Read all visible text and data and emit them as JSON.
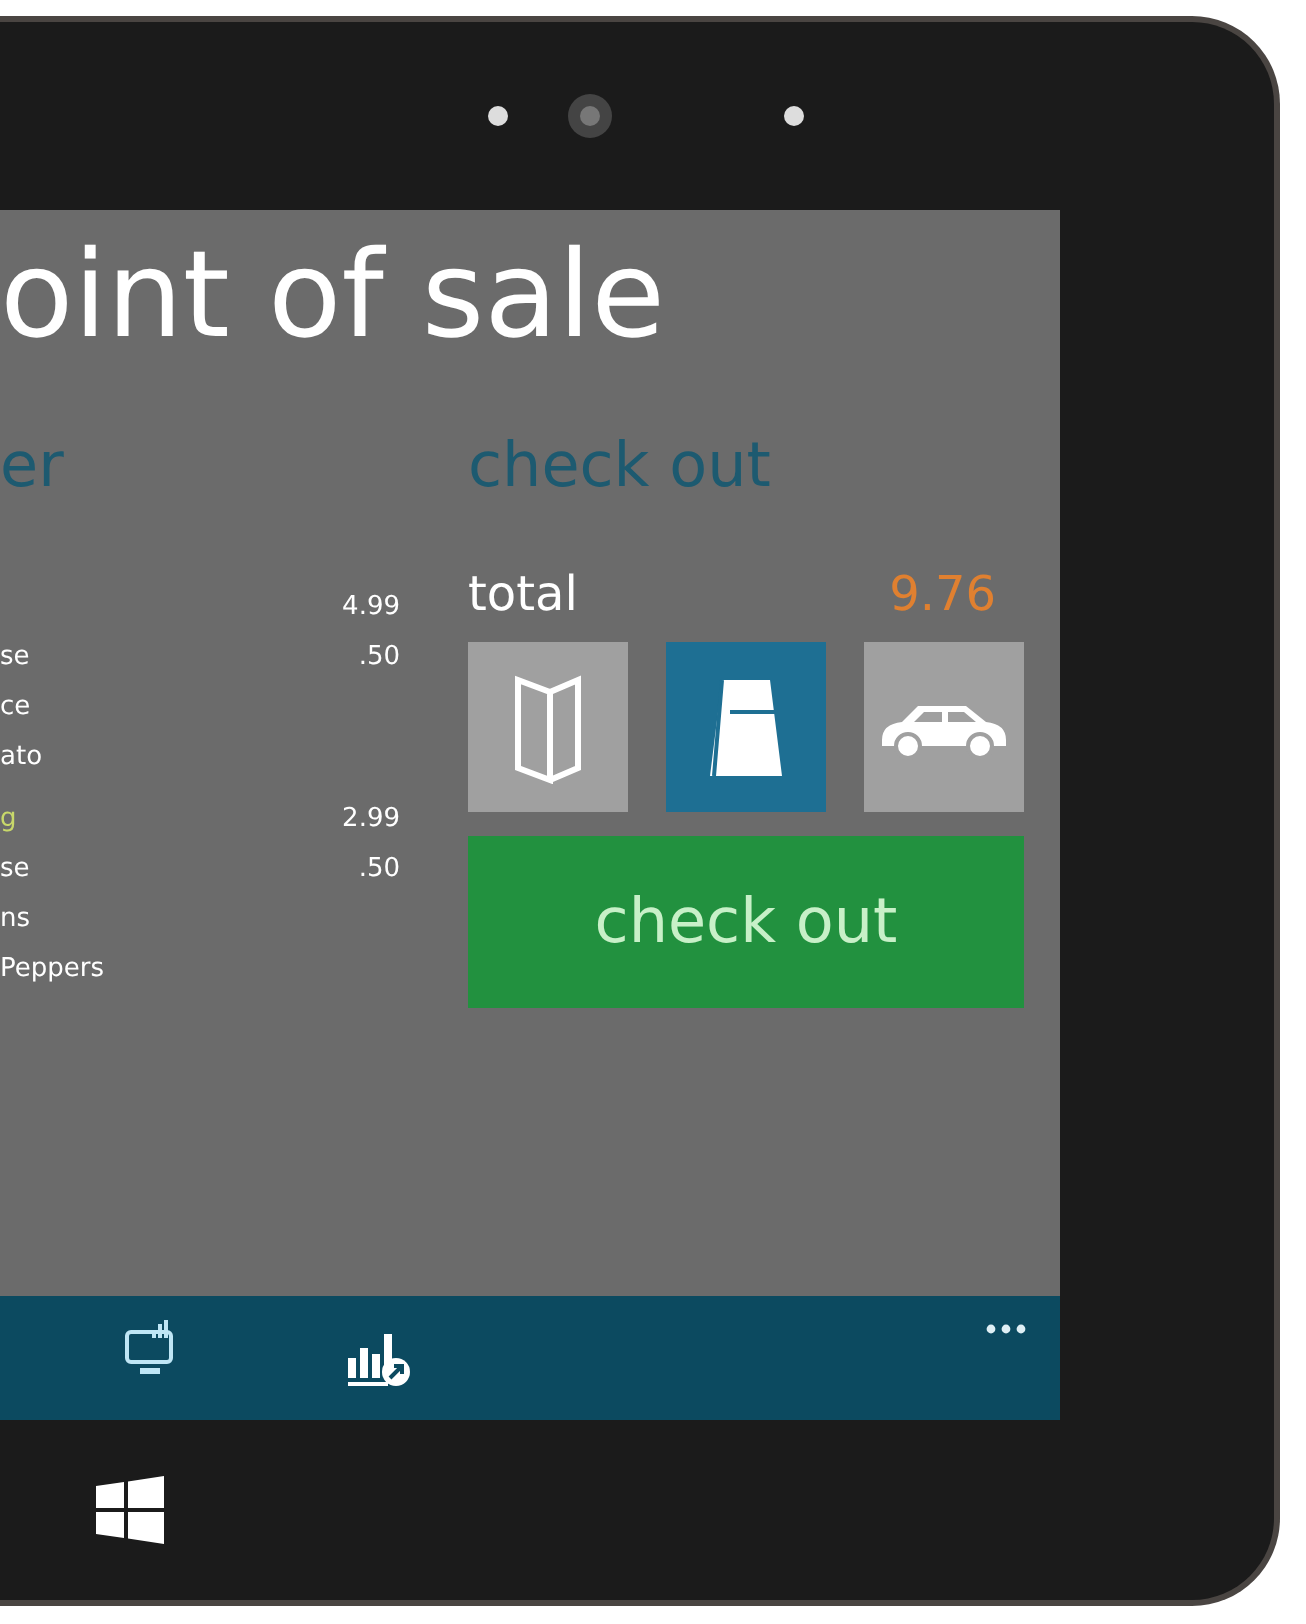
{
  "title": "oint of sale",
  "order": {
    "heading": "er",
    "lines": [
      {
        "kind": "item",
        "price": "4.99"
      },
      {
        "kind": "modifier",
        "name": "se",
        "price": ".50"
      },
      {
        "kind": "modifier",
        "name": "ce"
      },
      {
        "kind": "modifier",
        "name": "ato"
      },
      {
        "kind": "item",
        "name": "g",
        "price": "2.99"
      },
      {
        "kind": "modifier",
        "name": "se",
        "price": ".50"
      },
      {
        "kind": "modifier",
        "name": "ns"
      },
      {
        "kind": "modifier",
        "name": "Peppers"
      }
    ]
  },
  "checkout": {
    "heading": "check out",
    "total_label": "total",
    "total": "9.76",
    "order_types": [
      {
        "kind": "menu",
        "selected": false
      },
      {
        "kind": "bag",
        "selected": true
      },
      {
        "kind": "car",
        "selected": false
      }
    ],
    "button": "check out"
  }
}
